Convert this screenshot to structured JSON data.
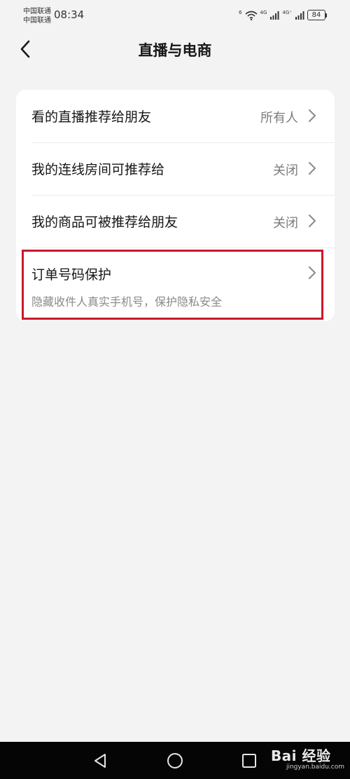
{
  "status_bar": {
    "carrier_1": "中国联通",
    "carrier_2": "中国联通",
    "time": "08:34",
    "wifi_label": "6",
    "signal_1_label": "4G",
    "signal_2_label": "4G⁺",
    "battery": "84"
  },
  "header": {
    "title": "直播与电商"
  },
  "settings": [
    {
      "label": "看的直播推荐给朋友",
      "value": "所有人"
    },
    {
      "label": "我的连线房间可推荐给",
      "value": "关闭"
    },
    {
      "label": "我的商品可被推荐给朋友",
      "value": "关闭"
    },
    {
      "label": "订单号码保护",
      "subtitle": "隐藏收件人真实手机号，保护隐私安全"
    }
  ],
  "watermark": {
    "main": "Bai 经验",
    "sub": "jingyan.baidu.com"
  },
  "colors": {
    "background": "#f3f3f4",
    "card": "#ffffff",
    "highlight": "#c9192b",
    "nav_bar": "#050505"
  }
}
